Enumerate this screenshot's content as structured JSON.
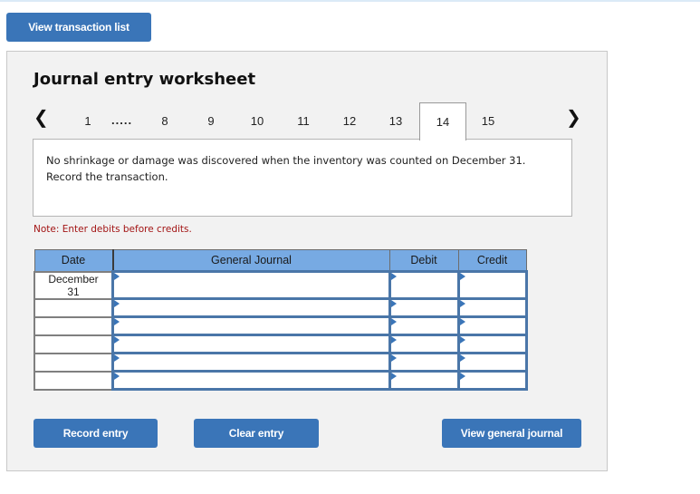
{
  "top_button": "View transaction list",
  "worksheet": {
    "title": "Journal entry worksheet",
    "nav": {
      "prev_icon": "chevron-left-icon",
      "next_icon": "chevron-right-icon",
      "first": "1",
      "ellipsis": ".....",
      "tabs": [
        "8",
        "9",
        "10",
        "11",
        "12",
        "13",
        "14",
        "15"
      ],
      "active": "14"
    },
    "description": "No shrinkage or damage was discovered when the inventory was counted on December 31. Record the transaction.",
    "note": "Note: Enter debits before credits.",
    "table": {
      "headers": {
        "date": "Date",
        "general_journal": "General Journal",
        "debit": "Debit",
        "credit": "Credit"
      },
      "rows": [
        {
          "date": "December 31",
          "account": "",
          "debit": "",
          "credit": ""
        },
        {
          "date": "",
          "account": "",
          "debit": "",
          "credit": ""
        },
        {
          "date": "",
          "account": "",
          "debit": "",
          "credit": ""
        },
        {
          "date": "",
          "account": "",
          "debit": "",
          "credit": ""
        },
        {
          "date": "",
          "account": "",
          "debit": "",
          "credit": ""
        },
        {
          "date": "",
          "account": "",
          "debit": "",
          "credit": ""
        }
      ]
    },
    "buttons": {
      "record": "Record entry",
      "clear": "Clear entry",
      "view_journal": "View general journal"
    },
    "colors": {
      "button": "#3a75b8",
      "header": "#77aae3",
      "note": "#a31515"
    }
  }
}
